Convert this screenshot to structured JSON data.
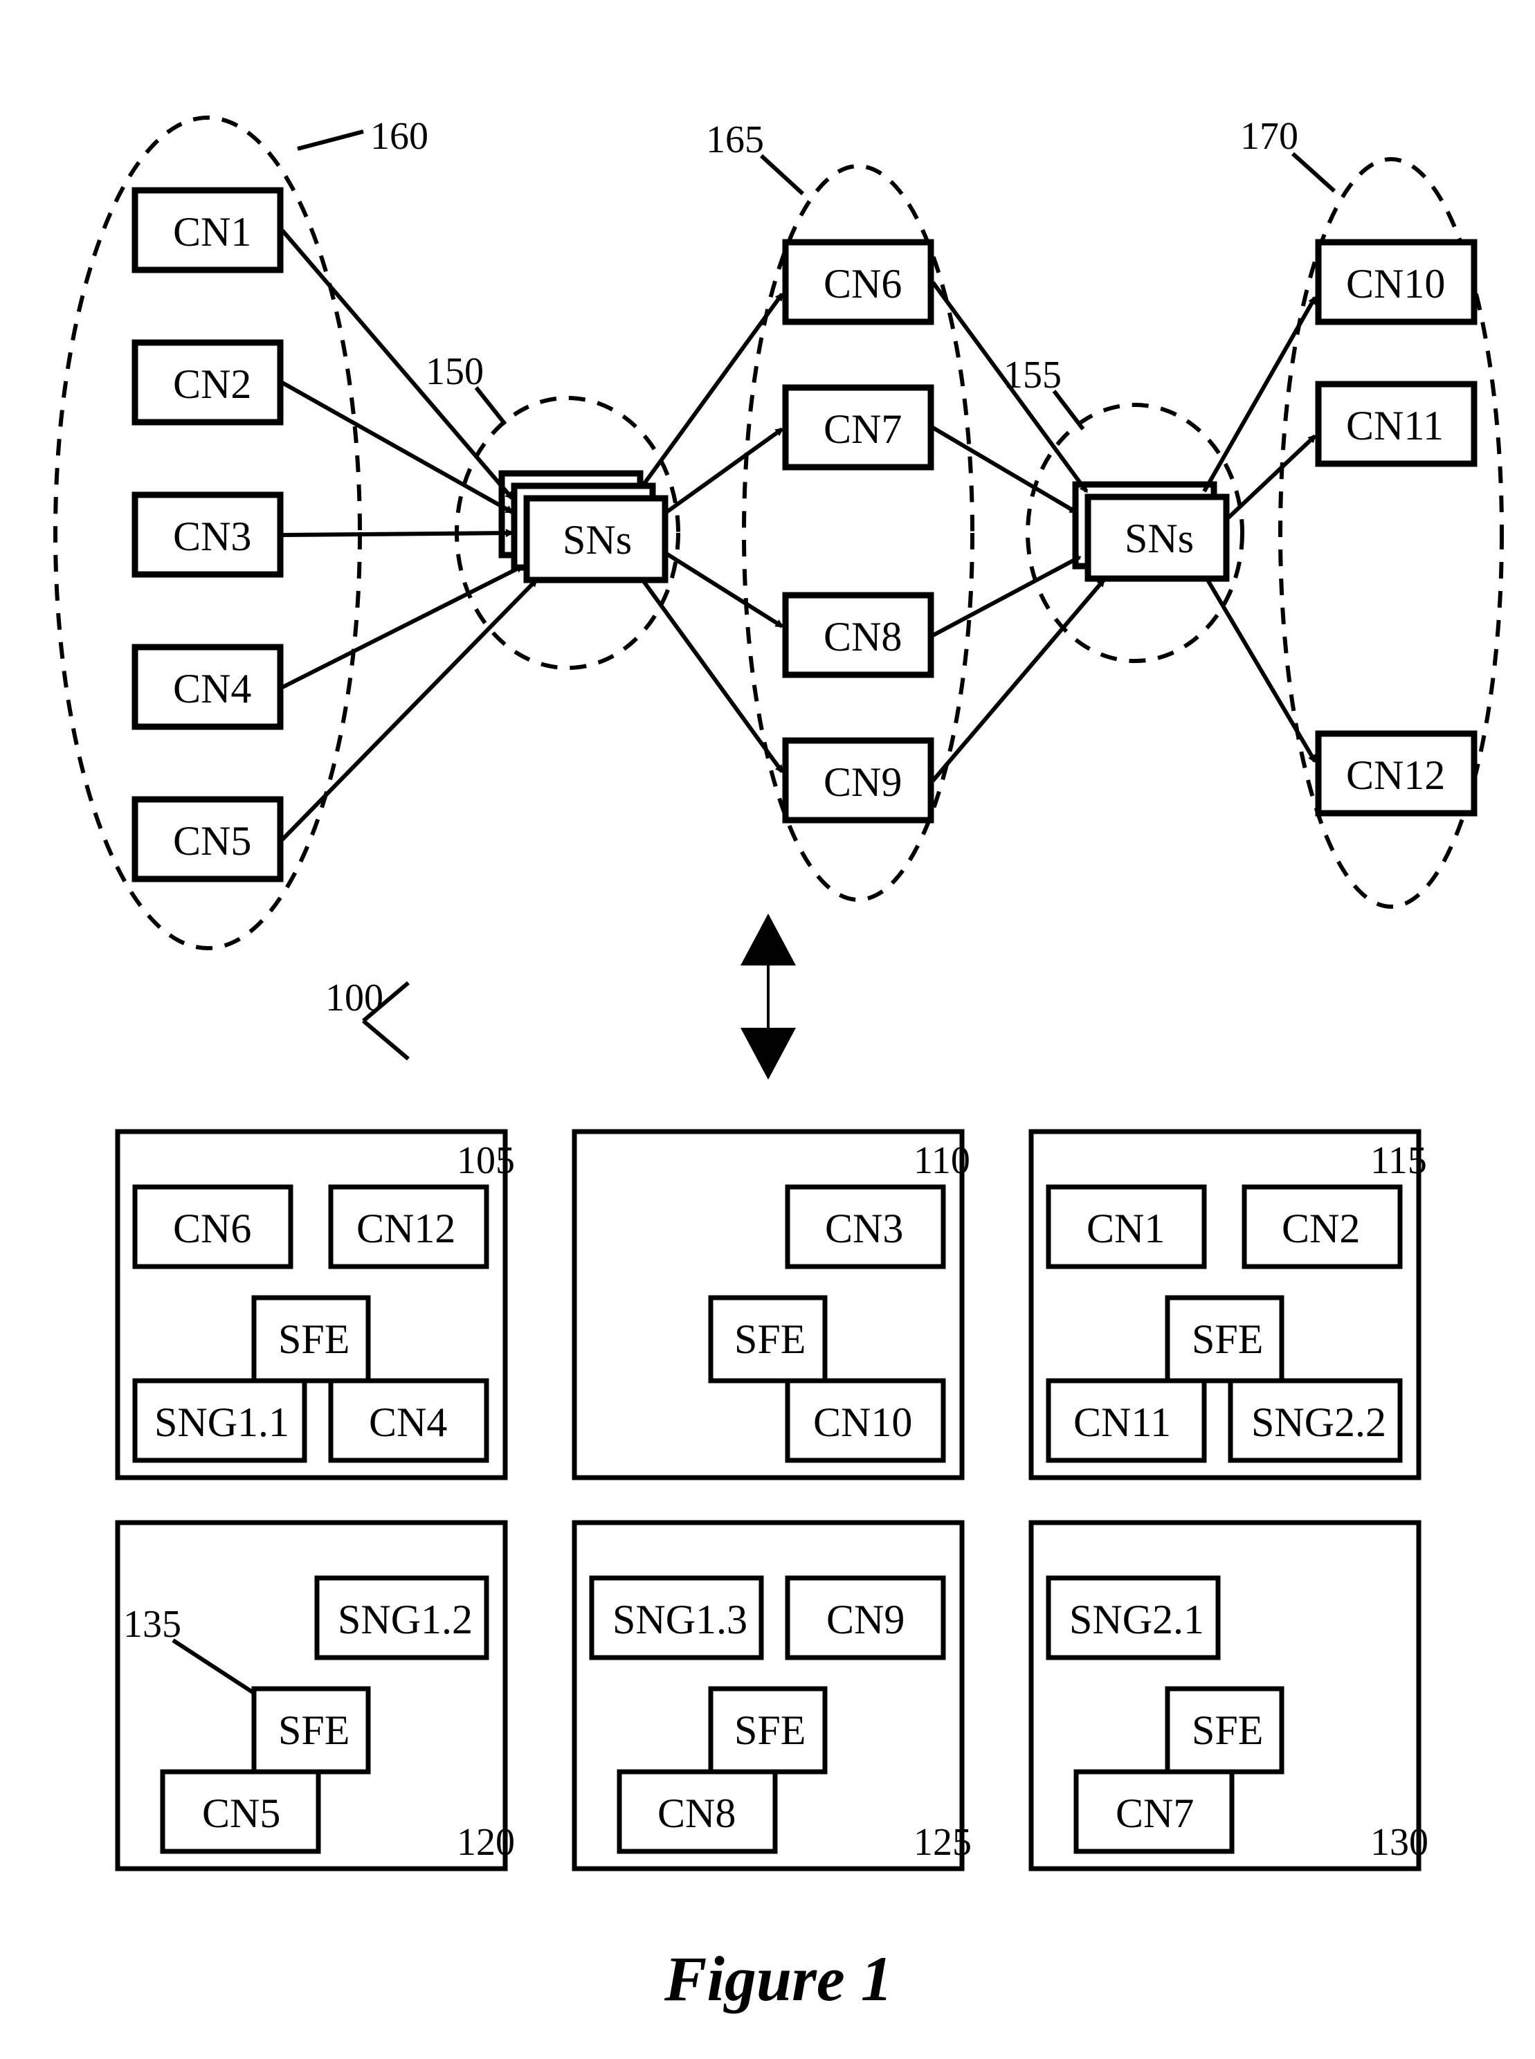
{
  "figure_label": "Figure 1",
  "system_ref": "100",
  "top": {
    "ellipse160": {
      "ref": "160",
      "nodes": [
        "CN1",
        "CN2",
        "CN3",
        "CN4",
        "CN5"
      ]
    },
    "ellipse150": {
      "ref": "150",
      "label": "SNs"
    },
    "ellipse165": {
      "ref": "165",
      "nodes": [
        "CN6",
        "CN7",
        "CN8",
        "CN9"
      ]
    },
    "ellipse155": {
      "ref": "155",
      "label": "SNs"
    },
    "ellipse170": {
      "ref": "170",
      "nodes": [
        "CN10",
        "CN11",
        "CN12"
      ]
    }
  },
  "host105": {
    "ref": "105",
    "sfe": "SFE",
    "nodes": [
      "CN6",
      "CN12",
      "SNG1.1",
      "CN4"
    ]
  },
  "host110": {
    "ref": "110",
    "sfe": "SFE",
    "nodes": [
      "CN3",
      "CN10"
    ]
  },
  "host115": {
    "ref": "115",
    "sfe": "SFE",
    "nodes": [
      "CN1",
      "CN2",
      "CN11",
      "SNG2.2"
    ]
  },
  "host120": {
    "ref": "120",
    "sfe": "SFE",
    "sfe_ref": "135",
    "nodes": [
      "SNG1.2",
      "CN5"
    ]
  },
  "host125": {
    "ref": "125",
    "sfe": "SFE",
    "nodes": [
      "SNG1.3",
      "CN9",
      "CN8"
    ]
  },
  "host130": {
    "ref": "130",
    "sfe": "SFE",
    "nodes": [
      "SNG2.1",
      "CN7"
    ]
  }
}
